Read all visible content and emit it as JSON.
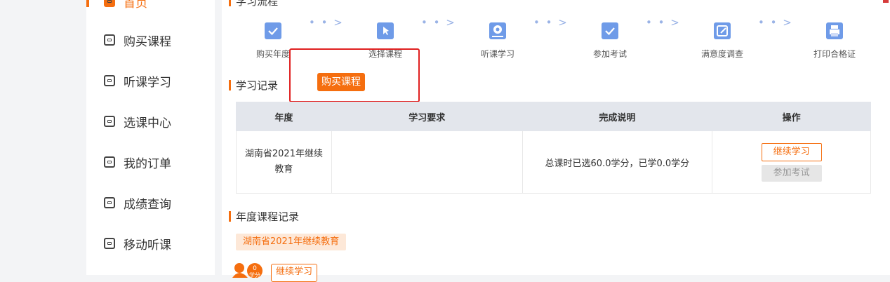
{
  "sidebar": {
    "items": [
      {
        "label": "首页",
        "icon": "home-icon",
        "active": true
      },
      {
        "label": "购买课程",
        "icon": "card-icon"
      },
      {
        "label": "听课学习",
        "icon": "video-icon"
      },
      {
        "label": "选课中心",
        "icon": "select-icon"
      },
      {
        "label": "我的订单",
        "icon": "order-icon"
      },
      {
        "label": "成绩查询",
        "icon": "score-icon"
      },
      {
        "label": "移动听课",
        "icon": "mobile-icon"
      }
    ]
  },
  "flow": {
    "title": "学习流程",
    "steps": [
      {
        "label": "购买年度",
        "icon": "check-icon"
      },
      {
        "label": "选择课程",
        "icon": "cursor-icon"
      },
      {
        "label": "听课学习",
        "icon": "play-icon"
      },
      {
        "label": "参加考试",
        "icon": "check-icon"
      },
      {
        "label": "满意度调查",
        "icon": "edit-icon"
      },
      {
        "label": "打印合格证",
        "icon": "printer-icon"
      }
    ],
    "arrow": "• • >"
  },
  "records": {
    "title": "学习记录",
    "buy_button": "购买课程",
    "headers": [
      "年度",
      "学习要求",
      "完成说明",
      "操作"
    ],
    "rows": [
      {
        "year": "湖南省2021年继续教育",
        "requirement": "",
        "description": "总课时已选60.0学分，已学0.0学分",
        "continue_label": "继续学习",
        "exam_label": "参加考试"
      }
    ]
  },
  "course_records": {
    "title": "年度课程记录",
    "year_tag": "湖南省2021年继续教育",
    "badge_value": "0",
    "badge_unit": "学分",
    "continue_label": "继续学习"
  },
  "colors": {
    "accent": "#f56e0f",
    "step_icon": "#6f9be8",
    "highlight": "#e02020"
  }
}
